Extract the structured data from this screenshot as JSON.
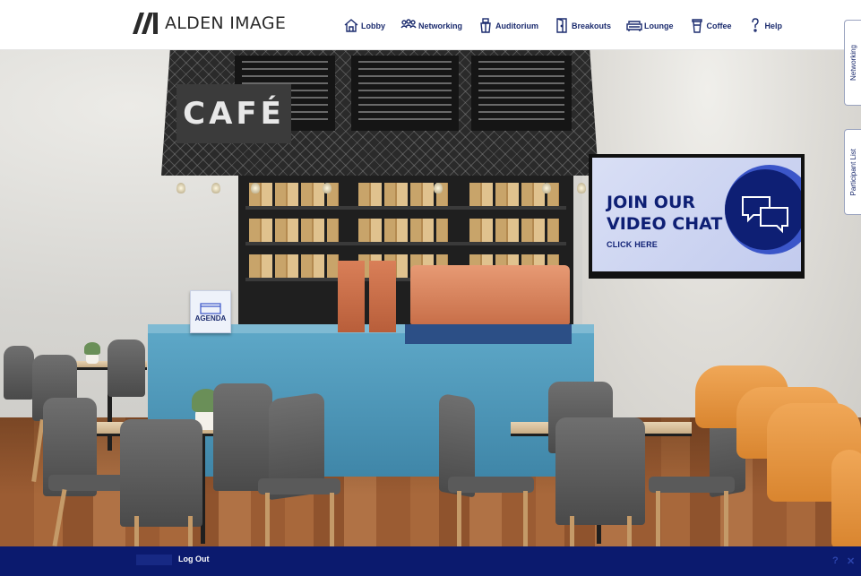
{
  "header": {
    "logo_text": "ALDEN IMAGE",
    "nav": [
      {
        "label": "Lobby",
        "icon": "home-icon"
      },
      {
        "label": "Networking",
        "icon": "people-icon"
      },
      {
        "label": "Auditorium",
        "icon": "podium-icon"
      },
      {
        "label": "Breakouts",
        "icon": "door-icon"
      },
      {
        "label": "Lounge",
        "icon": "sofa-icon"
      },
      {
        "label": "Coffee",
        "icon": "coffee-cup-icon"
      },
      {
        "label": "Help",
        "icon": "question-icon"
      }
    ]
  },
  "scene": {
    "cafe_sign": "CAFÉ",
    "agenda_label": "AGENDA",
    "tv": {
      "title_line1": "JOIN OUR",
      "title_line2": "VIDEO CHAT",
      "cta": "CLICK HERE"
    }
  },
  "side_tabs": {
    "networking": "Networking",
    "participants": "Participant List"
  },
  "footer": {
    "logout": "Log Out",
    "help": "?",
    "close": "✕"
  },
  "colors": {
    "brand_navy": "#0b1a6e",
    "nav_text": "#1b2b6e",
    "counter_blue": "#4a95b8",
    "accent_orange": "#e08a3a"
  }
}
